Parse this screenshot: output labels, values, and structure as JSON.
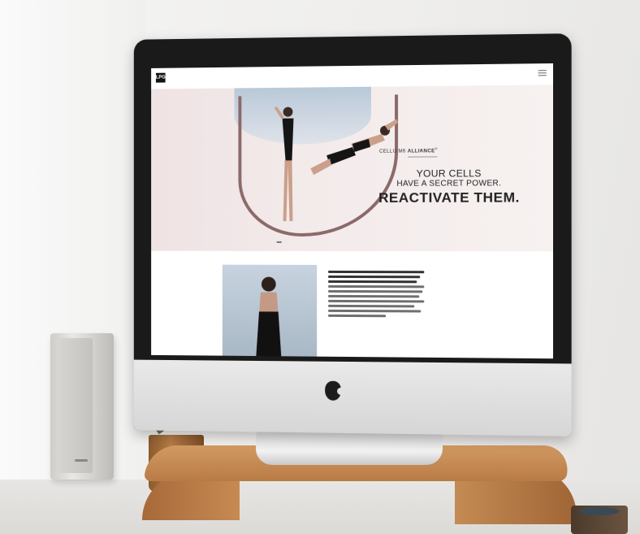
{
  "scene": {
    "hero": {
      "subtitle_prefix": "CELLU M6 ",
      "subtitle_brand": "ALLIANCE",
      "subtitle_mark": "®",
      "line1": "YOUR CELLS",
      "line2": "HAVE A SECRET POWER.",
      "line3": "REACTIVATE THEM."
    }
  },
  "colors": {
    "hero_bg": "#f4ecec",
    "wood": "#c78a52",
    "imac_bezel": "#1a1a1a"
  },
  "icons": [
    "apple-logo-icon",
    "hamburger-menu-icon"
  ]
}
